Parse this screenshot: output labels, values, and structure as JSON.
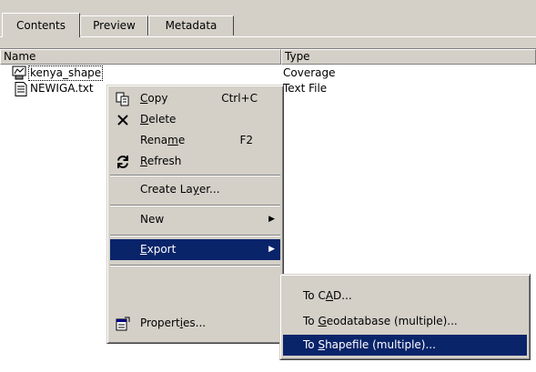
{
  "tabs": [
    {
      "label": "Contents"
    },
    {
      "label": "Preview"
    },
    {
      "label": "Metadata"
    }
  ],
  "list": {
    "columns": {
      "name": "Name",
      "type": "Type"
    },
    "rows": [
      {
        "name": "kenya_shape",
        "type": "Coverage",
        "icon": "coverage-icon"
      },
      {
        "name": "NEWIGA.txt",
        "type": "Text File",
        "icon": "text-file-icon"
      }
    ]
  },
  "context_menu": {
    "copy": {
      "pre": "",
      "u": "C",
      "post": "opy",
      "shortcut": "Ctrl+C"
    },
    "delete": {
      "pre": "",
      "u": "D",
      "post": "elete"
    },
    "rename": {
      "pre": "Rena",
      "u": "m",
      "post": "e",
      "shortcut": "F2"
    },
    "refresh": {
      "pre": "",
      "u": "R",
      "post": "efresh"
    },
    "create_layer": {
      "pre": "Create La",
      "u": "y",
      "post": "er..."
    },
    "new": {
      "label": "New"
    },
    "export": {
      "pre": "",
      "u": "E",
      "post": "xport"
    },
    "properties": {
      "pre": "Propert",
      "u": "i",
      "post": "es..."
    }
  },
  "export_submenu": {
    "cad": {
      "pre": "To C",
      "u": "A",
      "post": "D..."
    },
    "geodatabase": {
      "pre": "To ",
      "u": "G",
      "post": "eodatabase (multiple)..."
    },
    "shapefile": {
      "pre": "To ",
      "u": "S",
      "post": "hapefile (multiple)..."
    }
  },
  "colors": {
    "highlight": "#0a246a",
    "face": "#d4d0c8"
  }
}
